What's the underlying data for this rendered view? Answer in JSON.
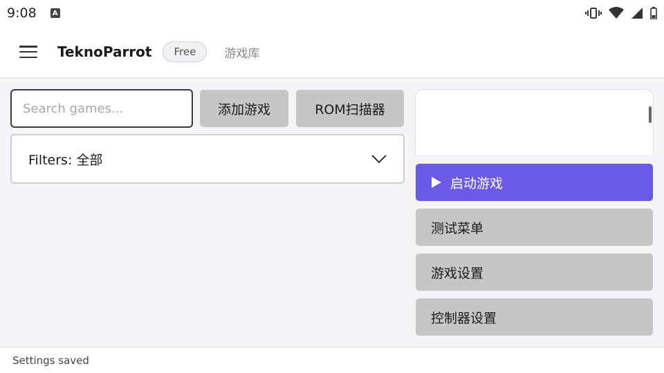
{
  "statusbar": {
    "time": "9:08",
    "notification_letter": "A"
  },
  "header": {
    "title": "TeknoParrot",
    "badge": "Free",
    "nav_link": "游戏库"
  },
  "toolbar": {
    "search_placeholder": "Search games...",
    "add_game_label": "添加游戏",
    "rom_scanner_label": "ROM扫描器"
  },
  "filters": {
    "label": "Filters: 全部"
  },
  "actions": {
    "launch_label": "启动游戏",
    "test_menu_label": "测试菜单",
    "game_settings_label": "游戏设置",
    "controller_settings_label": "控制器设置"
  },
  "footer": {
    "status": "Settings saved"
  },
  "colors": {
    "accent": "#6a5ae6",
    "button_gray": "#c6c6c6"
  }
}
